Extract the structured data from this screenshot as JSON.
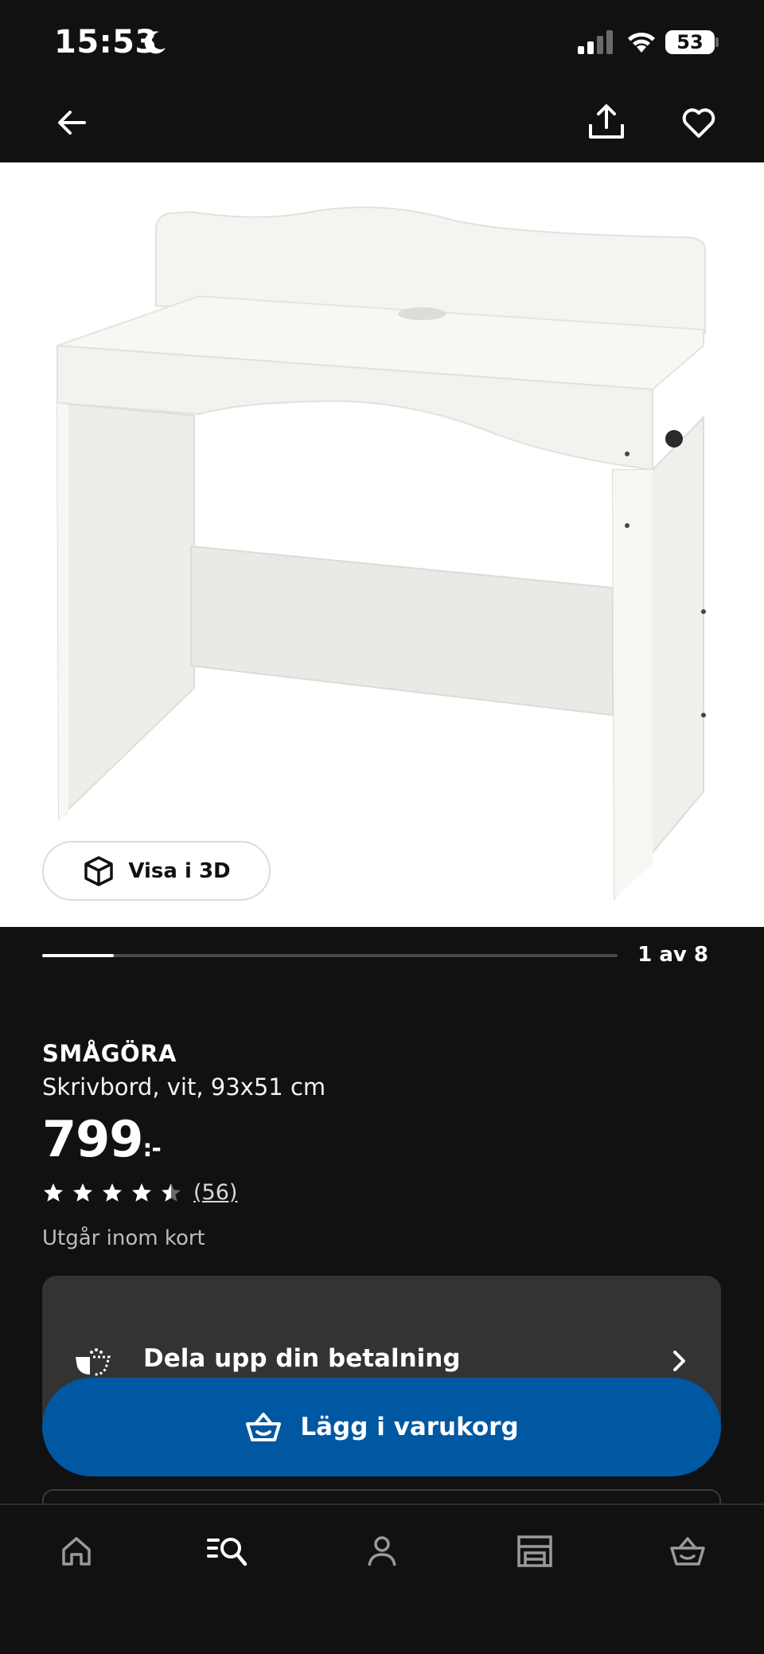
{
  "status_bar": {
    "time": "15:53",
    "battery": "53"
  },
  "top_nav": {
    "back_icon": "arrow-left-icon",
    "share_icon": "share-icon",
    "favorite_icon": "heart-icon"
  },
  "gallery": {
    "view_3d_label": "Visa i 3D",
    "counter": "1 av 8",
    "current": 1,
    "total": 8
  },
  "product": {
    "name": "SMÅGÖRA",
    "description": "Skrivbord, vit, 93x51 cm",
    "price": "799",
    "price_suffix": ":-",
    "rating": 4.5,
    "rating_count": "(56)",
    "availability": "Utgår inom kort"
  },
  "payment": {
    "label": "Dela upp din betalning"
  },
  "cart": {
    "label": "Lägg i varukorg"
  },
  "tabs": [
    {
      "name": "home",
      "icon": "home-icon"
    },
    {
      "name": "search",
      "icon": "search-list-icon",
      "active": true
    },
    {
      "name": "profile",
      "icon": "person-icon"
    },
    {
      "name": "store",
      "icon": "store-icon"
    },
    {
      "name": "cart",
      "icon": "basket-icon"
    }
  ],
  "colors": {
    "background": "#111111",
    "accent_blue": "#0058a3",
    "card_gray": "#333333"
  }
}
